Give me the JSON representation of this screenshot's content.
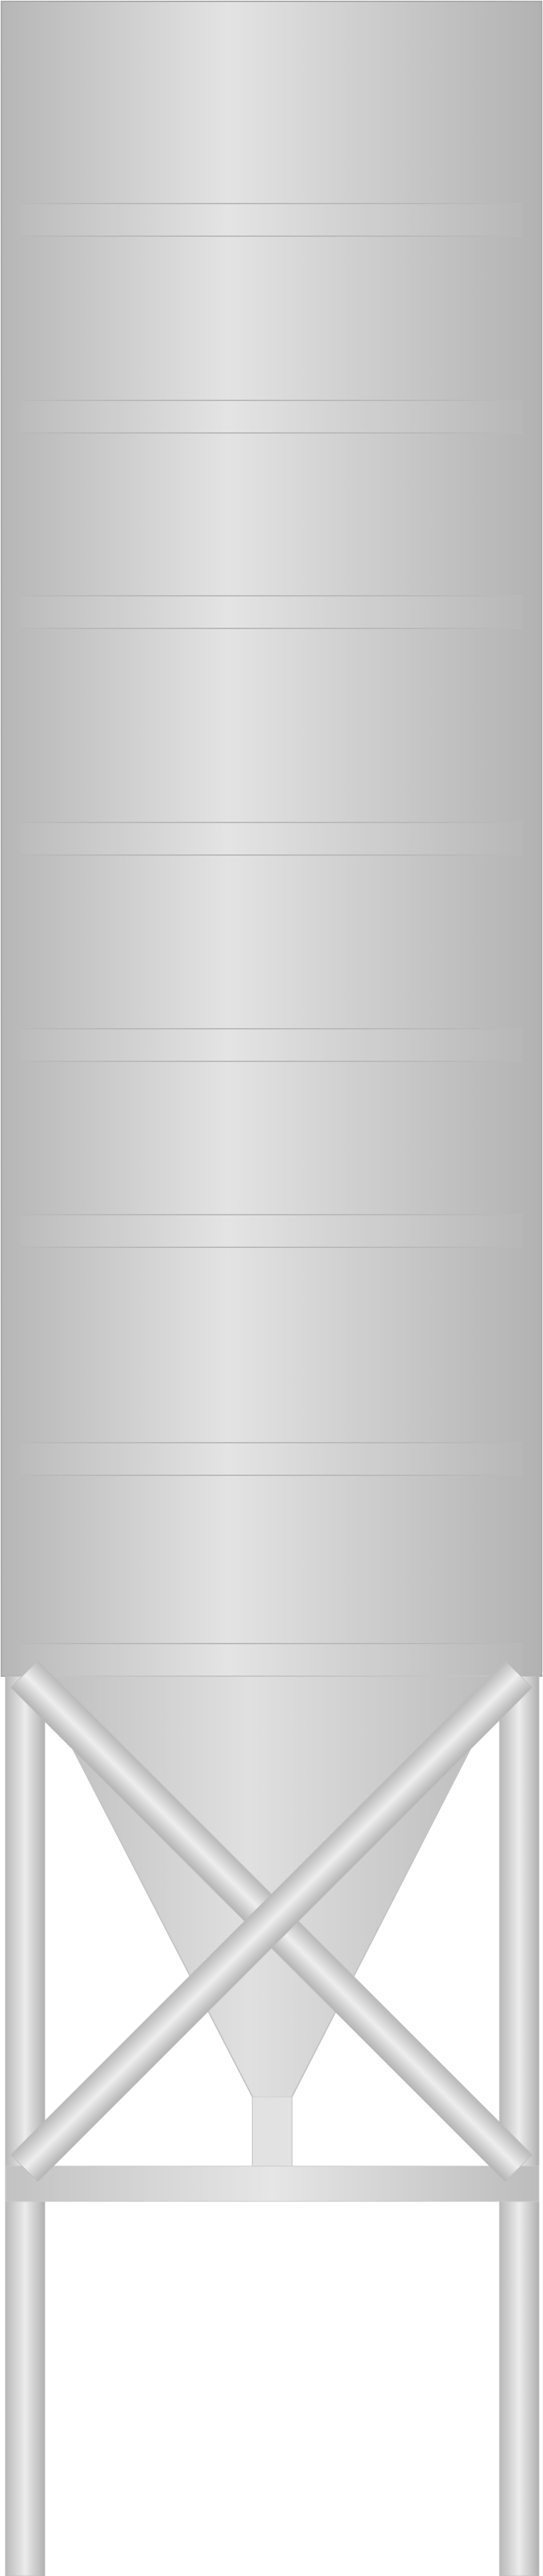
{
  "illustration": {
    "subject_icon": "silo-icon",
    "body_ring_count": 8,
    "colors": {
      "background": "#ffffff",
      "metal_dark": "#b4b4b4",
      "metal_mid": "#cfcfcf",
      "metal_light": "#e3e3e3",
      "seam_line": "#a9a9a9",
      "seam_band": "#dcdcdc",
      "edge": "#9e9e9e"
    }
  }
}
